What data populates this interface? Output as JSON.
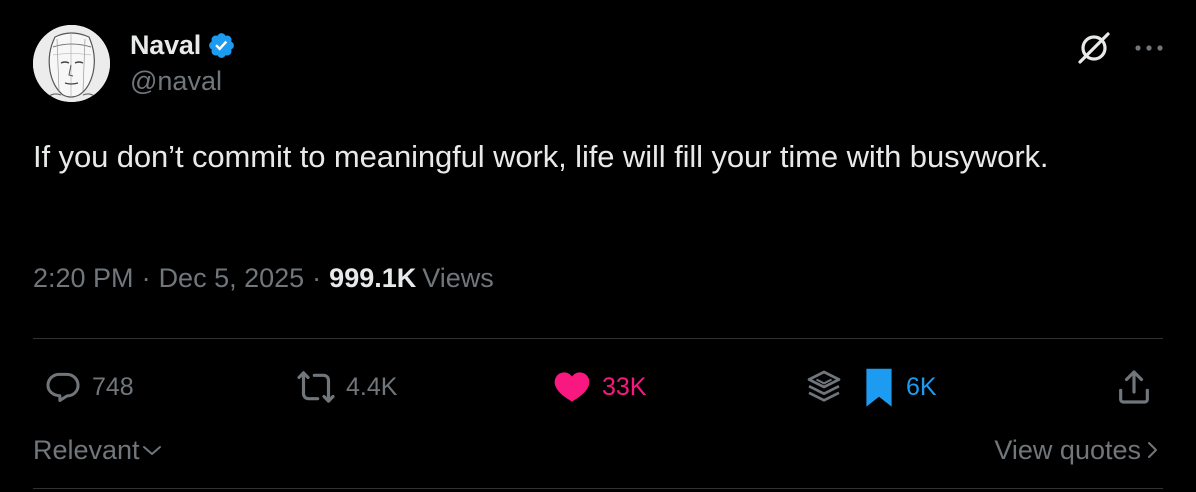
{
  "author": {
    "display_name": "Naval",
    "handle": "@naval",
    "verified": true,
    "verified_color": "#1d9bf0"
  },
  "tweet": {
    "text": "If you don’t commit to meaningful work, life will fill your time with busywork."
  },
  "meta": {
    "time": "2:20 PM",
    "separator": "·",
    "date": "Dec 5, 2025",
    "views_count": "999.1K",
    "views_label": "Views"
  },
  "actions": {
    "replies": "748",
    "reposts": "4.4K",
    "likes": "33K",
    "bookmarks": "6K"
  },
  "bottom": {
    "sort_label": "Relevant",
    "view_quotes_label": "View quotes"
  },
  "colors": {
    "background": "#000000",
    "primary_text": "#e7e9ea",
    "secondary_text": "#71767b",
    "like": "#f91880",
    "bookmark": "#1d9bf0",
    "divider": "#2f3336"
  },
  "icons": [
    "verified-badge-icon",
    "grok-icon",
    "more-icon",
    "reply-icon",
    "repost-icon",
    "like-icon",
    "grok-layers-icon",
    "bookmark-icon",
    "share-icon",
    "chevron-down-icon",
    "chevron-right-icon"
  ]
}
